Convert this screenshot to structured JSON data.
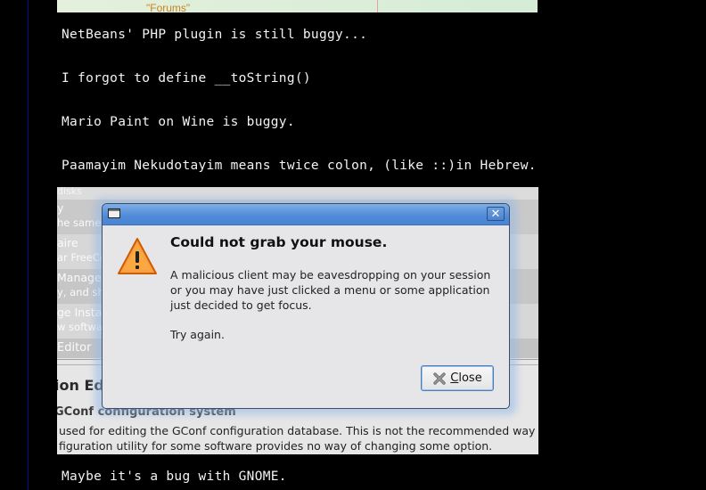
{
  "background": {
    "top_screenshot_label": "\"Forums\"",
    "chat_lines": [
      "NetBeans' PHP plugin is still buggy...",
      "I forgot to define __toString()",
      "Mario Paint on Wine is buggy.",
      "Paamayim Nekudotayim means twice colon, (like ::)in Hebrew.",
      "Maybe it's a bug with GNOME."
    ],
    "app_list": [
      {
        "line1": "disks",
        "line2": ""
      },
      {
        "line1": "y",
        "line2": "he same"
      },
      {
        "line1": "aire",
        "line2": "ar FreeCe"
      },
      {
        "line1": " Manage",
        "line2": "y, and sh"
      },
      {
        "line1": "ge Instal",
        "line2": "w softwar"
      },
      {
        "line1": "Editor",
        "line2": ""
      }
    ],
    "section_title": "ion Ed",
    "package_title": "GConf configuration system",
    "package_desc_line1": " used for editing the GConf configuration database. This is not the recommended way",
    "package_desc_line2": "figuration utility for some software provides no way of changing some option."
  },
  "dialog": {
    "heading": "Could not grab your mouse.",
    "message": "A malicious client may be eavesdropping on your session\nor you may have just clicked a menu or some application\njust decided to get focus.",
    "hint": "Try again.",
    "close_button": {
      "mnemonic": "C",
      "rest": "lose"
    },
    "titlebar_close_glyph": "✕",
    "colors": {
      "titlebar": "#4f8ad8",
      "warning": "#f57900"
    }
  }
}
